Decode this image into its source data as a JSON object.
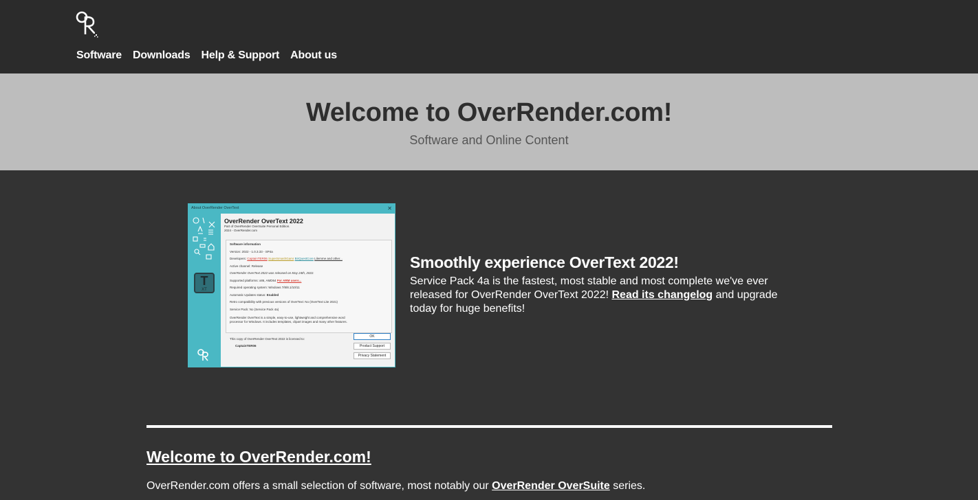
{
  "header": {
    "logo_text": "OR",
    "nav": [
      {
        "label": "Software"
      },
      {
        "label": "Downloads"
      },
      {
        "label": "Help & Support"
      },
      {
        "label": "About us"
      }
    ]
  },
  "hero": {
    "title": "Welcome to OverRender.com!",
    "subtitle": "Software and Online Content"
  },
  "feature": {
    "screenshot": {
      "window_title": "About OverRender OverText",
      "product_name": "OverRender OverText 2022",
      "edition_line": "Part of OverRender OverSuite Personal Edition.",
      "copyright_line": "2024 - OverRender.com",
      "section_header": "Software information",
      "version_line": "Version: 2022 - 1.0.3.33 - SP4a",
      "developers_label": "Developers:",
      "developer_names": [
        "CaptainTER06",
        "SuperSmashGamr",
        "BirQuestCore",
        "Lilemme and other..."
      ],
      "channel_line": "Active channel: Release",
      "release_line": "OverRender OverText 2022 was released on May 24th, 2022.",
      "platforms_label": "Supported platforms: x86, AMD64",
      "arm_link": "For ARM users...",
      "os_line": "Required operating system: Windows 7/8/8.1/10/11",
      "updates_label": "Automatic Updates status:",
      "updates_value": "Enabled",
      "compat_line": "Retro compatibility with previous versions of OverText: No (OverText Lite 2021)",
      "service_pack_line": "Service Pack: No (Service Pack 4a)",
      "description_line_1": "OverRender OverText is a simple, easy-to-use, lightweight and comprehensive word",
      "description_line_2": "processor for Windows. It includes templates, clipart images and many other features.",
      "license_line": "This copy of OverRender OverText 2022 is licensed to:",
      "licensee": "CaptainTER06",
      "ok_label": "OK",
      "support_label": "Product Support",
      "privacy_label": "Privacy Statement",
      "app_icon_letters": "T",
      "app_icon_sub": "XT"
    },
    "title": "Smoothly experience OverText 2022!",
    "body_before": "Service Pack 4a is the fastest, most stable and most complete we've ever released for OverRender OverText 2022! ",
    "changelog_link": "Read its changelog",
    "body_after": " and upgrade today for huge benefits!"
  },
  "intro": {
    "title": "Welcome to OverRender.com!",
    "text_before": "OverRender.com offers a small selection of software, most notably our ",
    "oversuite_link": "OverRender OverSuite",
    "text_after": " series."
  },
  "colors": {
    "header_bg": "#2b2b2b",
    "hero_bg": "#bdbdbd",
    "page_bg": "#333333",
    "accent_teal": "#4ab8c4"
  }
}
